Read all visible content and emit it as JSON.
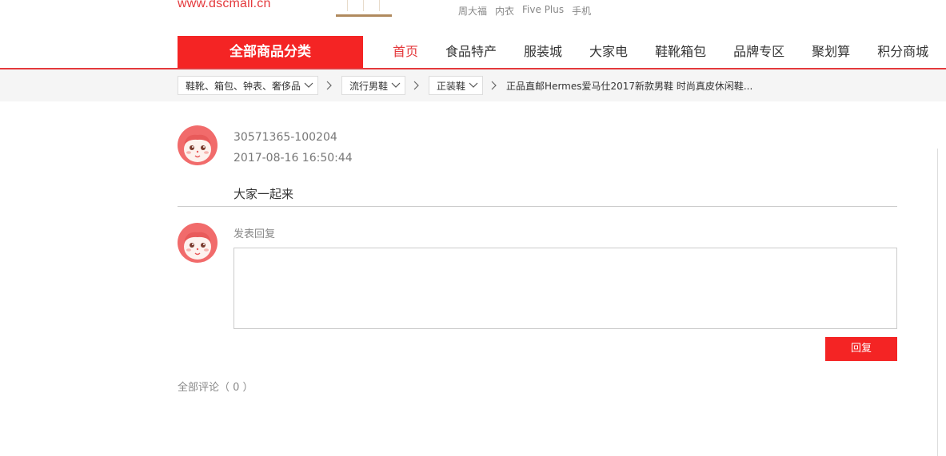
{
  "header": {
    "logo_url": "www.dscmall.cn",
    "hot_words": [
      "周大福",
      "内衣",
      "Five Plus",
      "手机"
    ]
  },
  "nav": {
    "all_categories": "全部商品分类",
    "items": [
      "首页",
      "食品特产",
      "服装城",
      "大家电",
      "鞋靴箱包",
      "品牌专区",
      "聚划算",
      "积分商城"
    ],
    "active_index": 0
  },
  "breadcrumb": {
    "levels": [
      "鞋靴、箱包、钟表、奢侈品",
      "流行男鞋",
      "正装鞋"
    ],
    "product": "正品直邮Hermes爱马仕2017新款男鞋 时尚真皮休闲鞋..."
  },
  "comment": {
    "user": "30571365-100204",
    "time": "2017-08-16 16:50:44",
    "text": "大家一起来"
  },
  "reply": {
    "label": "发表回复",
    "textarea_value": "",
    "button": "回复"
  },
  "all_comments": "全部评论（ 0 ）",
  "colors": {
    "accent": "#f42424",
    "nav_active": "#e4393c"
  },
  "icons": [
    "avatar-icon",
    "chevron-down-icon",
    "chevron-right-icon"
  ]
}
